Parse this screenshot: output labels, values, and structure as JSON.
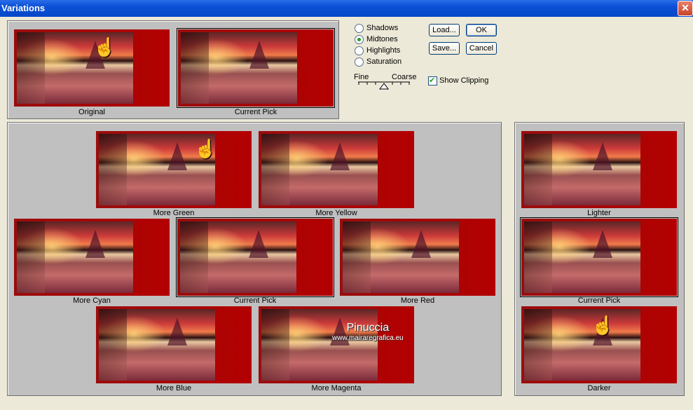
{
  "window": {
    "title": "Variations",
    "close_glyph": "✕"
  },
  "top": {
    "original_label": "Original",
    "current_label": "Current Pick"
  },
  "tones": [
    {
      "label": "Shadows",
      "checked": false
    },
    {
      "label": "Midtones",
      "checked": true
    },
    {
      "label": "Highlights",
      "checked": false
    },
    {
      "label": "Saturation",
      "checked": false
    }
  ],
  "buttons": {
    "load": "Load...",
    "ok": "OK",
    "save": "Save...",
    "cancel": "Cancel"
  },
  "scale": {
    "fine": "Fine",
    "coarse": "Coarse"
  },
  "show_clipping": {
    "label": "Show Clipping",
    "checked": true
  },
  "grid": {
    "more_green": "More Green",
    "more_yellow": "More Yellow",
    "more_cyan": "More Cyan",
    "current_pick": "Current Pick",
    "more_red": "More Red",
    "more_blue": "More Blue",
    "more_magenta": "More Magenta"
  },
  "lightness": {
    "lighter": "Lighter",
    "current_pick": "Current Pick",
    "darker": "Darker"
  },
  "watermark": {
    "name": "Pinuccia",
    "site": "www.mairaregrafica.eu"
  },
  "icons": {
    "pointer": "pointing-hand-icon",
    "close": "close-icon"
  }
}
